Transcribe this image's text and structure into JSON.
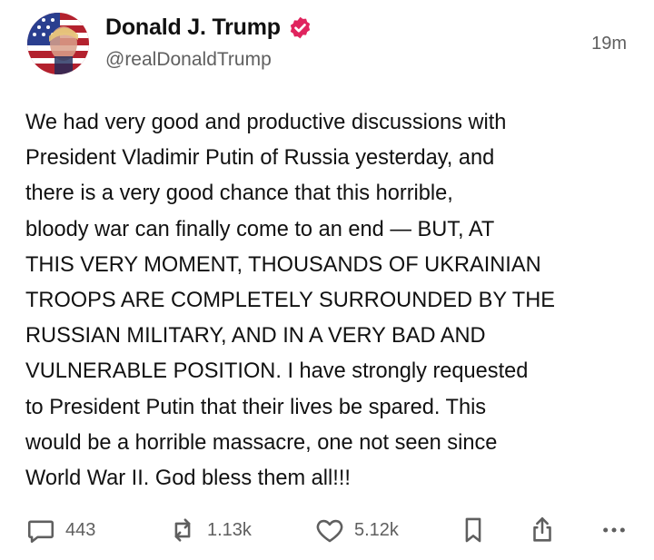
{
  "post": {
    "author_name": "Donald J. Trump",
    "author_handle": "@realDonaldTrump",
    "timestamp": "19m",
    "verified_icon": "verified-badge-icon",
    "verified_color": "#e0245e",
    "body_lines": [
      "We had very good and productive discussions with",
      "President Vladimir Putin of Russia yesterday, and",
      "there is a very good chance that this horrible,",
      "bloody war can finally come to an end — BUT, AT",
      "THIS VERY MOMENT, THOUSANDS OF UKRAINIAN",
      "TROOPS ARE COMPLETELY SURROUNDED BY THE",
      "RUSSIAN MILITARY, AND IN A VERY BAD AND",
      "VULNERABLE POSITION. I have strongly requested",
      "to President Putin that their lives be spared. This",
      "would be a horrible massacre, one not seen since",
      "World War II. God bless them all!!!"
    ]
  },
  "actions": {
    "reply": {
      "icon": "reply-icon",
      "count": "443"
    },
    "retruth": {
      "icon": "retruth-icon",
      "count": "1.13k"
    },
    "like": {
      "icon": "heart-icon",
      "count": "5.12k"
    },
    "bookmark": {
      "icon": "bookmark-icon"
    },
    "share": {
      "icon": "share-icon"
    },
    "more": {
      "icon": "more-icon"
    }
  }
}
